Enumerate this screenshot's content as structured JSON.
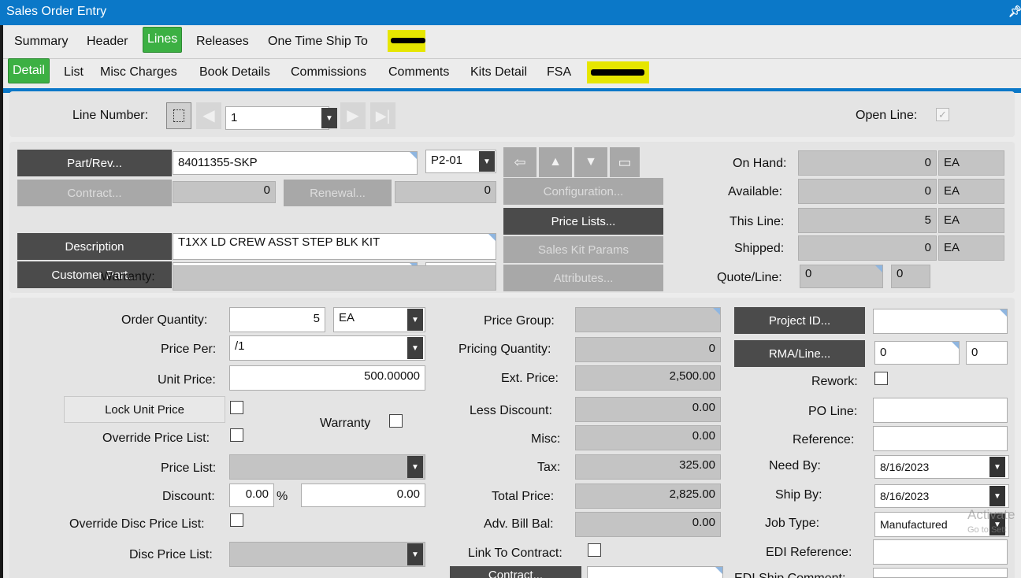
{
  "window": {
    "title": "Sales Order Entry",
    "pin_icon": "pin-icon"
  },
  "tabs": {
    "summary": "Summary",
    "header": "Header",
    "lines": "Lines",
    "releases": "Releases",
    "one_time_ship_to": "One Time Ship To"
  },
  "subtabs": {
    "detail": "Detail",
    "list": "List",
    "misc_charges": "Misc Charges",
    "book_details": "Book Details",
    "commissions": "Commissions",
    "comments": "Comments",
    "kits_detail": "Kits Detail",
    "fsa": "FSA"
  },
  "line_nav": {
    "label": "Line Number:",
    "value": "1",
    "open_line_label": "Open Line:",
    "open_line_checked": true
  },
  "part": {
    "part_rev_button": "Part/Rev...",
    "part_value": "84011355-SKP",
    "rev_value": "P2-01",
    "contract_button": "Contract...",
    "contract_value": "0",
    "renewal_button": "Renewal...",
    "renewal_value": "0",
    "description_button": "Description",
    "description_value": "T1XX LD CREW ASST STEP BLK KIT",
    "customer_part_button": "Customer Part...",
    "warranty_label": "Warranty:",
    "configuration_button": "Configuration...",
    "price_lists_button": "Price Lists...",
    "sales_kit_params_button": "Sales Kit Params",
    "attributes_button": "Attributes..."
  },
  "stock": {
    "on_hand_label": "On Hand:",
    "on_hand": "0",
    "on_hand_uom": "EA",
    "available_label": "Available:",
    "available": "0",
    "available_uom": "EA",
    "this_line_label": "This Line:",
    "this_line": "5",
    "this_line_uom": "EA",
    "shipped_label": "Shipped:",
    "shipped": "0",
    "shipped_uom": "EA",
    "quote_line_label": "Quote/Line:",
    "quote": "0",
    "quote_line": "0"
  },
  "pricing": {
    "order_qty_label": "Order Quantity:",
    "order_qty": "5",
    "order_uom": "EA",
    "price_per_label": "Price Per:",
    "price_per": "/1",
    "unit_price_label": "Unit Price:",
    "unit_price": "500.00000",
    "lock_unit_price_button": "Lock Unit Price",
    "warranty_label": "Warranty",
    "override_price_list_label": "Override Price List:",
    "price_list_label": "Price List:",
    "discount_label": "Discount:",
    "discount_pct": "0.00",
    "pct_symbol": "%",
    "discount_amt": "0.00",
    "override_disc_label": "Override Disc Price List:",
    "disc_price_list_label": "Disc Price List:"
  },
  "totals": {
    "price_group_label": "Price Group:",
    "pricing_qty_label": "Pricing Quantity:",
    "pricing_qty": "0",
    "ext_price_label": "Ext. Price:",
    "ext_price": "2,500.00",
    "less_discount_label": "Less Discount:",
    "less_discount": "0.00",
    "misc_label": "Misc:",
    "misc": "0.00",
    "tax_label": "Tax:",
    "tax": "325.00",
    "total_price_label": "Total Price:",
    "total_price": "2,825.00",
    "adv_bill_label": "Adv. Bill Bal:",
    "adv_bill": "0.00",
    "link_contract_label": "Link To Contract:",
    "contract_button": "Contract..."
  },
  "right": {
    "project_id_button": "Project ID...",
    "rma_line_button": "RMA/Line...",
    "rma": "0",
    "rma_line": "0",
    "rework_label": "Rework:",
    "po_line_label": "PO Line:",
    "reference_label": "Reference:",
    "need_by_label": "Need By:",
    "need_by": "8/16/2023",
    "ship_by_label": "Ship By:",
    "ship_by": "8/16/2023",
    "job_type_label": "Job Type:",
    "job_type": "Manufactured",
    "edi_reference_label": "EDI Reference:",
    "edi_ship_comment_label": "EDI Ship Comment:"
  },
  "watermark": {
    "line1": "Activate",
    "line2": "Go to Sett"
  },
  "colors": {
    "title_bar": "#0b78c8",
    "active_tab": "#3cb043",
    "button": "#4b4b4b",
    "highlight": "#e6e600"
  }
}
